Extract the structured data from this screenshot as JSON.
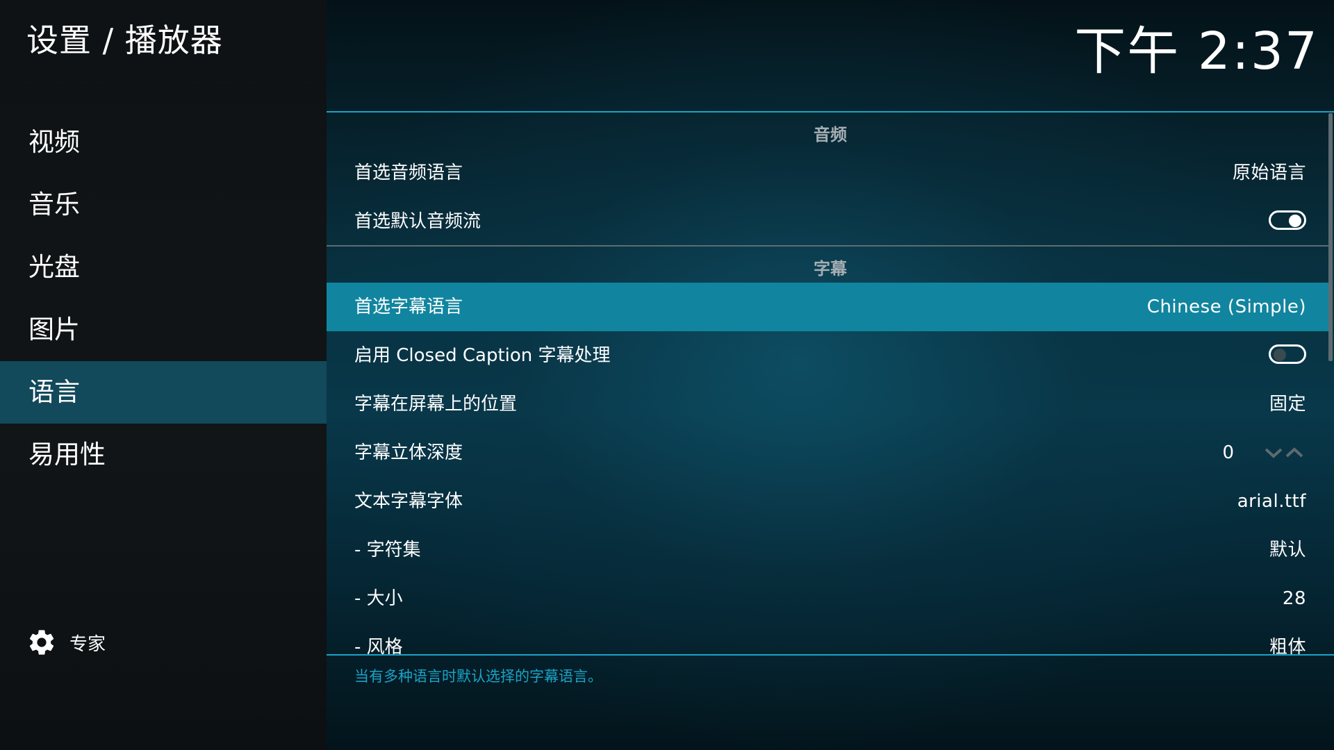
{
  "header": {
    "title": "设置 / 播放器",
    "clock": "下午 2:37"
  },
  "sidebar": {
    "items": [
      {
        "label": "视频",
        "active": false
      },
      {
        "label": "音乐",
        "active": false
      },
      {
        "label": "光盘",
        "active": false
      },
      {
        "label": "图片",
        "active": false
      },
      {
        "label": "语言",
        "active": true
      },
      {
        "label": "易用性",
        "active": false
      }
    ],
    "settings_level": {
      "label": "专家",
      "icon": "gear-icon"
    }
  },
  "sections": {
    "audio": {
      "title": "音频"
    },
    "subtitles": {
      "title": "字幕"
    }
  },
  "settings": {
    "preferred_audio_language": {
      "label": "首选音频语言",
      "value": "原始语言"
    },
    "prefer_default_audio_stream": {
      "label": "首选默认音频流",
      "value": true
    },
    "preferred_subtitle_language": {
      "label": "首选字幕语言",
      "value": "Chinese (Simple)",
      "focused": true
    },
    "closed_caption": {
      "label": "启用 Closed Caption 字幕处理",
      "value": false
    },
    "subtitle_position": {
      "label": "字幕在屏幕上的位置",
      "value": "固定"
    },
    "stereoscopic_depth": {
      "label": "字幕立体深度",
      "value": "0"
    },
    "text_font": {
      "label": "文本字幕字体",
      "value": "arial.ttf"
    },
    "charset": {
      "label": "- 字符集",
      "value": "默认"
    },
    "size": {
      "label": "- 大小",
      "value": "28"
    },
    "style": {
      "label": "- 风格",
      "value": "粗体"
    }
  },
  "description": "当有多种语言时默认选择的字幕语言。",
  "colors": {
    "accent": "#1aa3c6",
    "focused_row": "#11859f",
    "active_nav": "#12495b"
  }
}
